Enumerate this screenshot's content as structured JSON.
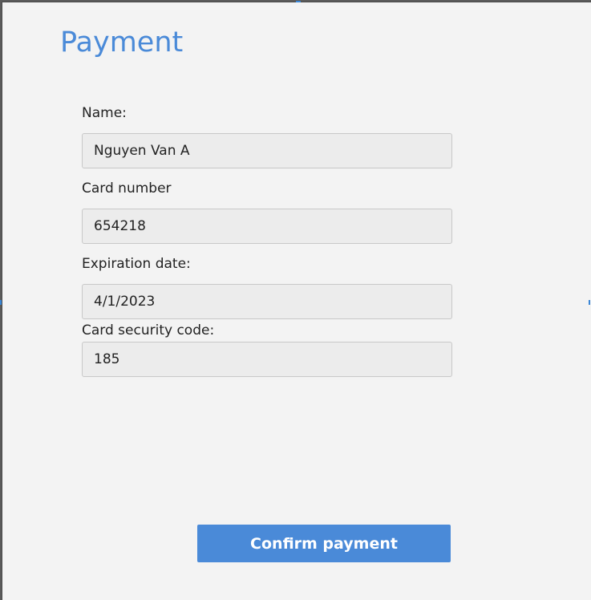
{
  "title": "Payment",
  "form": {
    "name": {
      "label": "Name:",
      "value": "Nguyen Van A"
    },
    "card_number": {
      "label": "Card number",
      "value": "654218"
    },
    "expiration_date": {
      "label": "Expiration date:",
      "value": "4/1/2023"
    },
    "security_code": {
      "label": "Card security code:",
      "value": "185"
    }
  },
  "confirm_label": "Confirm payment",
  "colors": {
    "accent": "#4a8ad8",
    "background": "#f3f3f3",
    "field_background": "#ececec",
    "field_border": "#c8c8c8",
    "text": "#222222"
  }
}
